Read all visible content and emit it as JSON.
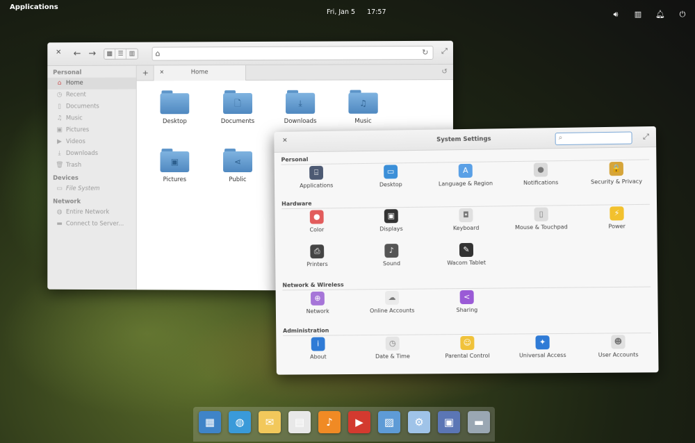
{
  "panel": {
    "applications_label": "Applications",
    "date": "Fri, Jan 5",
    "time": "17:57",
    "tray": [
      "volume-icon",
      "network-icon",
      "notifications-icon",
      "power-icon"
    ]
  },
  "files": {
    "sidebar": {
      "personal_heading": "Personal",
      "personal": [
        {
          "label": "Home",
          "icon": "home-icon"
        },
        {
          "label": "Recent",
          "icon": "recent-icon"
        },
        {
          "label": "Documents",
          "icon": "documents-icon"
        },
        {
          "label": "Music",
          "icon": "music-icon"
        },
        {
          "label": "Pictures",
          "icon": "pictures-icon"
        },
        {
          "label": "Videos",
          "icon": "videos-icon"
        },
        {
          "label": "Downloads",
          "icon": "downloads-icon"
        },
        {
          "label": "Trash",
          "icon": "trash-icon"
        }
      ],
      "devices_heading": "Devices",
      "devices": [
        {
          "label": "File System",
          "icon": "drive-icon"
        }
      ],
      "network_heading": "Network",
      "network": [
        {
          "label": "Entire Network",
          "icon": "network-icon"
        },
        {
          "label": "Connect to Server...",
          "icon": "server-icon"
        }
      ]
    },
    "tab_title": "Home",
    "folders": [
      {
        "label": "Desktop",
        "glyph": ""
      },
      {
        "label": "Documents",
        "glyph": "🗋"
      },
      {
        "label": "Downloads",
        "glyph": "⤓"
      },
      {
        "label": "Music",
        "glyph": "♫"
      },
      {
        "label": "Pictures",
        "glyph": "▣"
      },
      {
        "label": "Public",
        "glyph": "⋖"
      }
    ]
  },
  "settings": {
    "title": "System Settings",
    "search_placeholder": "",
    "sections": [
      {
        "heading": "Personal",
        "items": [
          {
            "label": "Applications",
            "icon": "applications-icon",
            "color": "#4d5a73",
            "glyph": "⌸"
          },
          {
            "label": "Desktop",
            "icon": "desktop-icon",
            "color": "#3b8fd8",
            "glyph": "▭"
          },
          {
            "label": "Language & Region",
            "icon": "language-icon",
            "color": "#5aa0e6",
            "glyph": "A"
          },
          {
            "label": "Notifications",
            "icon": "notifications-icon",
            "color": "#d9d9d9",
            "glyph": "●"
          },
          {
            "label": "Security & Privacy",
            "icon": "lock-icon",
            "color": "#d6a53a",
            "glyph": "🔒"
          }
        ]
      },
      {
        "heading": "Hardware",
        "items": [
          {
            "label": "Color",
            "icon": "color-icon",
            "color": "#e25c5c",
            "glyph": "●"
          },
          {
            "label": "Displays",
            "icon": "displays-icon",
            "color": "#333333",
            "glyph": "▣"
          },
          {
            "label": "Keyboard",
            "icon": "keyboard-icon",
            "color": "#e0e0e0",
            "glyph": "◘"
          },
          {
            "label": "Mouse & Touchpad",
            "icon": "mouse-icon",
            "color": "#dddddd",
            "glyph": "▯"
          },
          {
            "label": "Power",
            "icon": "power-icon",
            "color": "#f2c12e",
            "glyph": "⚡"
          },
          {
            "label": "Printers",
            "icon": "printer-icon",
            "color": "#444444",
            "glyph": "⎙"
          },
          {
            "label": "Sound",
            "icon": "sound-icon",
            "color": "#555555",
            "glyph": "♪"
          },
          {
            "label": "Wacom Tablet",
            "icon": "tablet-icon",
            "color": "#333333",
            "glyph": "✎"
          }
        ]
      },
      {
        "heading": "Network & Wireless",
        "items": [
          {
            "label": "Network",
            "icon": "network-icon",
            "color": "#a675d8",
            "glyph": "⊕"
          },
          {
            "label": "Online Accounts",
            "icon": "cloud-icon",
            "color": "#eaeaea",
            "glyph": "☁"
          },
          {
            "label": "Sharing",
            "icon": "sharing-icon",
            "color": "#9a5ad6",
            "glyph": "<"
          }
        ]
      },
      {
        "heading": "Administration",
        "items": [
          {
            "label": "About",
            "icon": "about-icon",
            "color": "#2f7bd6",
            "glyph": "i"
          },
          {
            "label": "Date & Time",
            "icon": "clock-icon",
            "color": "#e5e5e5",
            "glyph": "◷"
          },
          {
            "label": "Parental Control",
            "icon": "parental-icon",
            "color": "#f0c23a",
            "glyph": "☺"
          },
          {
            "label": "Universal Access",
            "icon": "accessibility-icon",
            "color": "#2f7bd6",
            "glyph": "✦"
          },
          {
            "label": "User Accounts",
            "icon": "users-icon",
            "color": "#e0e0e0",
            "glyph": "☻"
          }
        ]
      }
    ]
  },
  "dock": [
    {
      "icon": "multitasking-icon",
      "color": "#3f84c8",
      "glyph": "▦"
    },
    {
      "icon": "browser-icon",
      "color": "#3a9ad9",
      "glyph": "◍"
    },
    {
      "icon": "mail-icon",
      "color": "#f2c85b",
      "glyph": "✉"
    },
    {
      "icon": "calendar-icon",
      "color": "#e8e8e8",
      "glyph": "▤"
    },
    {
      "icon": "music-icon",
      "color": "#f08a24",
      "glyph": "♪"
    },
    {
      "icon": "videos-icon",
      "color": "#d33a2f",
      "glyph": "▶"
    },
    {
      "icon": "photos-icon",
      "color": "#5e9bd6",
      "glyph": "▨"
    },
    {
      "icon": "settings-icon",
      "color": "#9fc3e8",
      "glyph": "⚙"
    },
    {
      "icon": "store-icon",
      "color": "#5b76b5",
      "glyph": "▣"
    },
    {
      "icon": "files-icon",
      "color": "#9aa7b3",
      "glyph": "▬"
    }
  ]
}
